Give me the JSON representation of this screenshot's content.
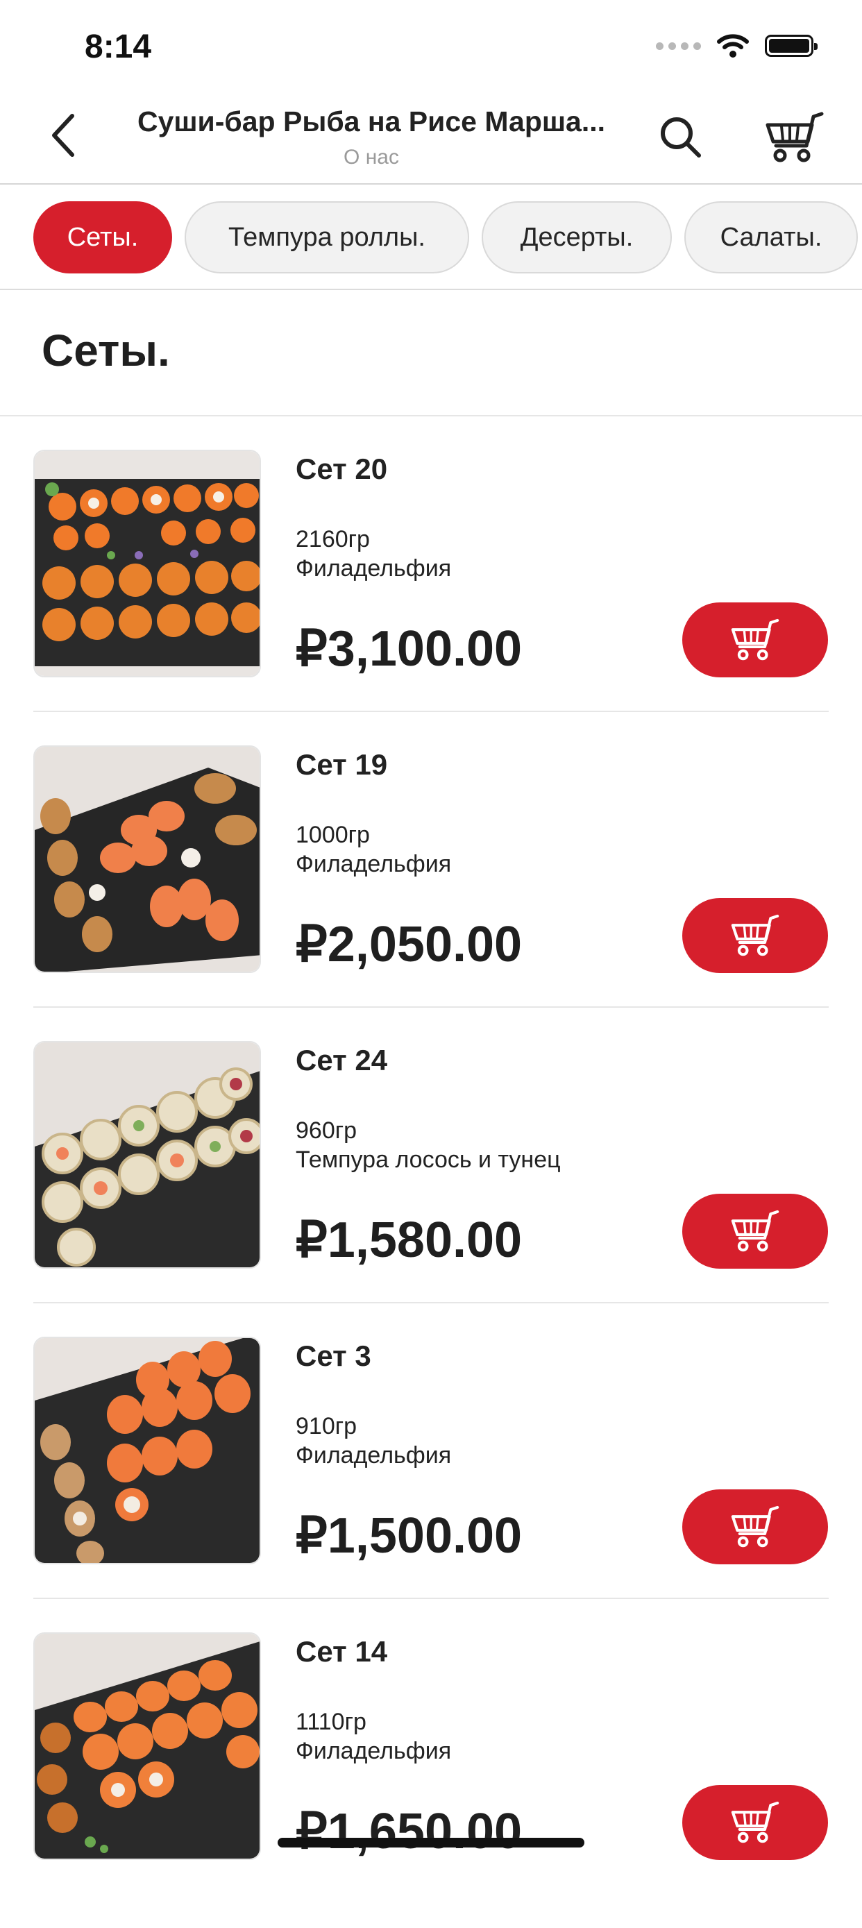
{
  "status": {
    "time": "8:14"
  },
  "nav": {
    "title": "Суши-бар Рыба на Рисе Марша...",
    "subtitle": "О нас"
  },
  "tabs": [
    {
      "label": "Сеты.",
      "active": true
    },
    {
      "label": "Темпура роллы.",
      "active": false
    },
    {
      "label": "Десерты.",
      "active": false
    },
    {
      "label": "Салаты.",
      "active": false
    }
  ],
  "section": {
    "title": "Сеты."
  },
  "products": [
    {
      "name": "Сет 20",
      "weight": "2160гр",
      "desc": "Филадельфия",
      "price": "₽3,100.00"
    },
    {
      "name": "Сет 19",
      "weight": "1000гр",
      "desc": "Филадельфия",
      "price": "₽2,050.00"
    },
    {
      "name": "Сет 24",
      "weight": "960гр",
      "desc": "Темпура лосось и тунец",
      "price": "₽1,580.00"
    },
    {
      "name": "Сет 3",
      "weight": "910гр",
      "desc": "Филадельфия",
      "price": "₽1,500.00"
    },
    {
      "name": "Сет 14",
      "weight": "1110гр",
      "desc": "Филадельфия",
      "price": "₽1,650.00"
    }
  ],
  "colors": {
    "accent": "#d61f2c",
    "tab_inactive_bg": "#f2f2f2",
    "text": "#1f1f1f",
    "muted": "#9a9a9a"
  },
  "icons": {
    "back": "chevron-left-icon",
    "search": "search-icon",
    "cart": "cart-icon",
    "add_to_cart": "cart-icon"
  }
}
